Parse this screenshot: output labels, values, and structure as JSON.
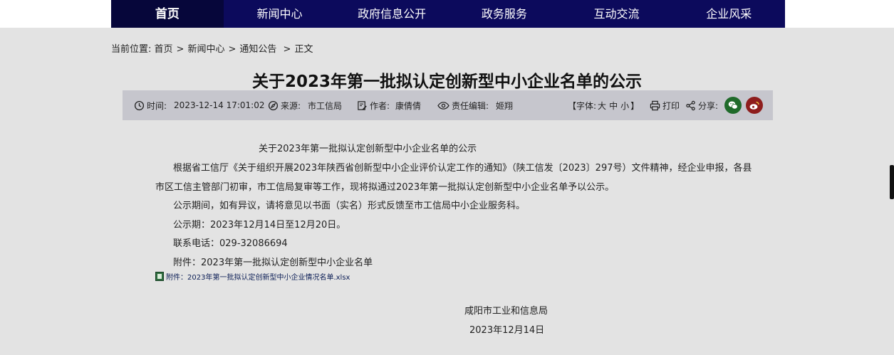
{
  "nav": {
    "items": [
      {
        "label": "首页",
        "active": true
      },
      {
        "label": "新闻中心",
        "active": false
      },
      {
        "label": "政府信息公开",
        "active": false
      },
      {
        "label": "政务服务",
        "active": false
      },
      {
        "label": "互动交流",
        "active": false
      },
      {
        "label": "企业风采",
        "active": false
      }
    ]
  },
  "breadcrumb": {
    "prefix": "当前位置:",
    "home": "首页",
    "news": "新闻中心",
    "notice": "通知公告",
    "current": "正文",
    "sep": ">"
  },
  "article": {
    "title": "关于2023年第一批拟认定创新型中小企业名单的公示"
  },
  "meta": {
    "time_label": "时间:",
    "time_value": "2023-12-14 17:01:02",
    "source_label": "来源:",
    "source_value": "市工信局",
    "author_label": "作者:",
    "author_value": "康倩倩",
    "editor_label": "责任编辑:",
    "editor_value": "姬翔",
    "font_open": "【字体:",
    "font_big": "大",
    "font_mid": "中",
    "font_small": "小",
    "font_close": "】",
    "print_label": "打印",
    "share_label": "分享:",
    "wechat_color": "#1f6a2a",
    "weibo_color": "#8e1d1d"
  },
  "body": {
    "sub_title": "关于2023年第一批拟认定创新型中小企业名单的公示",
    "para1_line1": "根据省工信厅《关于组织开展2023年陕西省创新型中小企业评价认定工作的通知》（陕工信发〔2023〕297号）文件精神，经企业申报，各县",
    "para1_line2": "市区工信主管部门初审，市工信局复审等工作，现将拟通过2023年第一批拟认定创新型中小企业名单予以公示。",
    "para2": "公示期间，如有异议，请将意见以书面（实名）形式反馈至市工信局中小企业服务科。",
    "period": "公示期：2023年12月14日至12月20日。",
    "phone": "联系电话：029-32086694",
    "attachment_text": "附件：2023年第一批拟认定创新型中小企业名单",
    "attachment_link": "附件：2023年第一批拟认定创新型中小企业情况名单.xlsx",
    "sign_org": "咸阳市工业和信息局",
    "sign_date": "2023年12月14日"
  }
}
